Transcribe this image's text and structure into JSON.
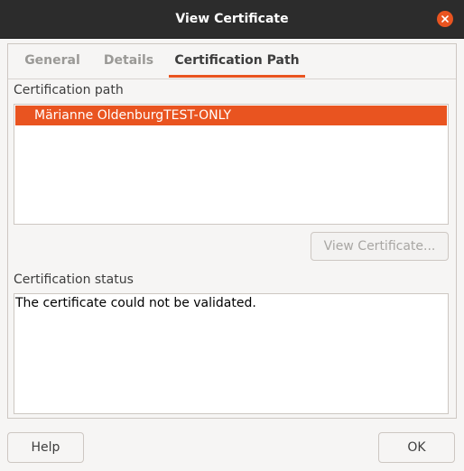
{
  "window": {
    "title": "View Certificate",
    "close_icon": "close-icon"
  },
  "tabs": [
    {
      "label": "General",
      "active": false
    },
    {
      "label": "Details",
      "active": false
    },
    {
      "label": "Certification Path",
      "active": true
    }
  ],
  "certification_path": {
    "label": "Certification path",
    "items": [
      {
        "name": "Märianne OldenburgTEST-ONLY",
        "selected": true
      }
    ],
    "view_button_label": "View Certificate...",
    "view_button_enabled": false
  },
  "certification_status": {
    "label": "Certification status",
    "text": "The certificate could not be validated."
  },
  "footer": {
    "help_label": "Help",
    "ok_label": "OK"
  },
  "colors": {
    "accent": "#e95420",
    "titlebar": "#2c2c2c"
  }
}
